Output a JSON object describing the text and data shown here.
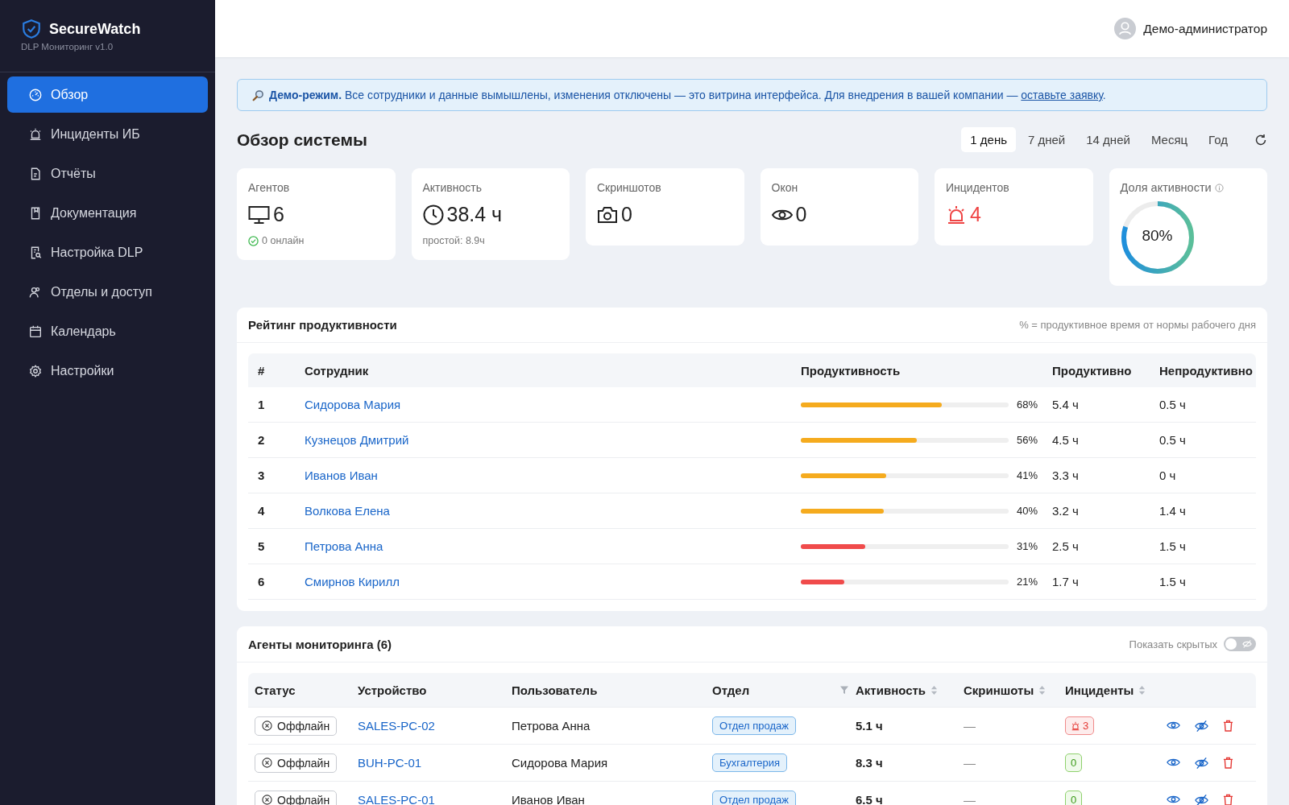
{
  "sidebar": {
    "brand": "SecureWatch",
    "subtitle": "DLP Мониторинг v1.0",
    "items": [
      {
        "label": "Обзор",
        "selected": true
      },
      {
        "label": "Инциденты ИБ",
        "selected": false
      },
      {
        "label": "Отчёты",
        "selected": false
      },
      {
        "label": "Документация",
        "selected": false
      },
      {
        "label": "Настройка DLP",
        "selected": false
      },
      {
        "label": "Отделы и доступ",
        "selected": false
      },
      {
        "label": "Календарь",
        "selected": false
      },
      {
        "label": "Настройки",
        "selected": false
      }
    ]
  },
  "header": {
    "user": "Демо-администратор"
  },
  "banner": {
    "text": "**Демо-режим.** Все сотрудники и данные вымышлены, изменения отключены — это витрина интерфейса. Для внедрения в вашей компании —",
    "link": "оставьте заявку",
    "tail": "."
  },
  "page_title": "Обзор системы",
  "periods": [
    {
      "label": "1 день",
      "selected": true
    },
    {
      "label": "7 дней",
      "selected": false
    },
    {
      "label": "14 дней",
      "selected": false
    },
    {
      "label": "Месяц",
      "selected": false
    },
    {
      "label": "Год",
      "selected": false
    }
  ],
  "stats": [
    {
      "kind": "agents",
      "label": "Агентов",
      "value": "6",
      "sub": "0 онлайн"
    },
    {
      "kind": "activity",
      "label": "Активность",
      "value": "38.4 ч",
      "sub": "простой: 8.9ч"
    },
    {
      "kind": "screenshots",
      "label": "Скриншотов",
      "value": "0"
    },
    {
      "kind": "windows",
      "label": "Окон",
      "value": "0"
    },
    {
      "kind": "incidents",
      "label": "Инцидентов",
      "value": "4"
    }
  ],
  "activity_share": {
    "label": "Доля активности",
    "value": "80%",
    "level": 0.8
  },
  "ranking": {
    "title": "Рейтинг продуктивности",
    "note": "% = продуктивное время от нормы рабочего дня",
    "columns": [
      "#",
      "Сотрудник",
      "Продуктивность",
      "Продуктивно",
      "Непродуктивно"
    ],
    "rows": [
      {
        "rank": "1",
        "name": "Сидорова Мария",
        "level": 0.68,
        "percent": "68%",
        "color": "#f5ab1e",
        "productive": "5.4 ч",
        "unproductive": "0.5 ч"
      },
      {
        "rank": "2",
        "name": "Кузнецов Дмитрий",
        "level": 0.56,
        "percent": "56%",
        "color": "#f5ab1e",
        "productive": "4.5 ч",
        "unproductive": "0.5 ч"
      },
      {
        "rank": "3",
        "name": "Иванов Иван",
        "level": 0.41,
        "percent": "41%",
        "color": "#f5ab1e",
        "productive": "3.3 ч",
        "unproductive": "0 ч"
      },
      {
        "rank": "4",
        "name": "Волкова Елена",
        "level": 0.4,
        "percent": "40%",
        "color": "#f5ab1e",
        "productive": "3.2 ч",
        "unproductive": "1.4 ч"
      },
      {
        "rank": "5",
        "name": "Петрова Анна",
        "level": 0.31,
        "percent": "31%",
        "color": "#f04b4b",
        "productive": "2.5 ч",
        "unproductive": "1.5 ч"
      },
      {
        "rank": "6",
        "name": "Смирнов Кирилл",
        "level": 0.21,
        "percent": "21%",
        "color": "#f04b4b",
        "productive": "1.7 ч",
        "unproductive": "1.5 ч"
      }
    ]
  },
  "agents": {
    "title": "Агенты мониторинга (6)",
    "toggle_label": "Показать скрытых",
    "show_hidden": false,
    "columns": [
      {
        "label": "Статус",
        "kind": "plain"
      },
      {
        "label": "Устройство",
        "kind": "plain"
      },
      {
        "label": "Пользователь",
        "kind": "plain"
      },
      {
        "label": "Отдел",
        "kind": "filter"
      },
      {
        "label": "Активность",
        "kind": "sort"
      },
      {
        "label": "Скриншоты",
        "kind": "sort"
      },
      {
        "label": "Инциденты",
        "kind": "sort"
      }
    ],
    "rows": [
      {
        "status": "Оффлайн",
        "device": "SALES-PC-02",
        "user": "Петрова Анна",
        "department": "Отдел продаж",
        "activity": "5.1 ч",
        "screenshots": "—",
        "incidents": "3",
        "alert": true
      },
      {
        "status": "Оффлайн",
        "device": "BUH-PC-01",
        "user": "Сидорова Мария",
        "department": "Бухгалтерия",
        "activity": "8.3 ч",
        "screenshots": "—",
        "incidents": "0",
        "alert": false
      },
      {
        "status": "Оффлайн",
        "device": "SALES-PC-01",
        "user": "Иванов Иван",
        "department": "Отдел продаж",
        "activity": "6.5 ч",
        "screenshots": "—",
        "incidents": "0",
        "alert": false
      }
    ]
  }
}
